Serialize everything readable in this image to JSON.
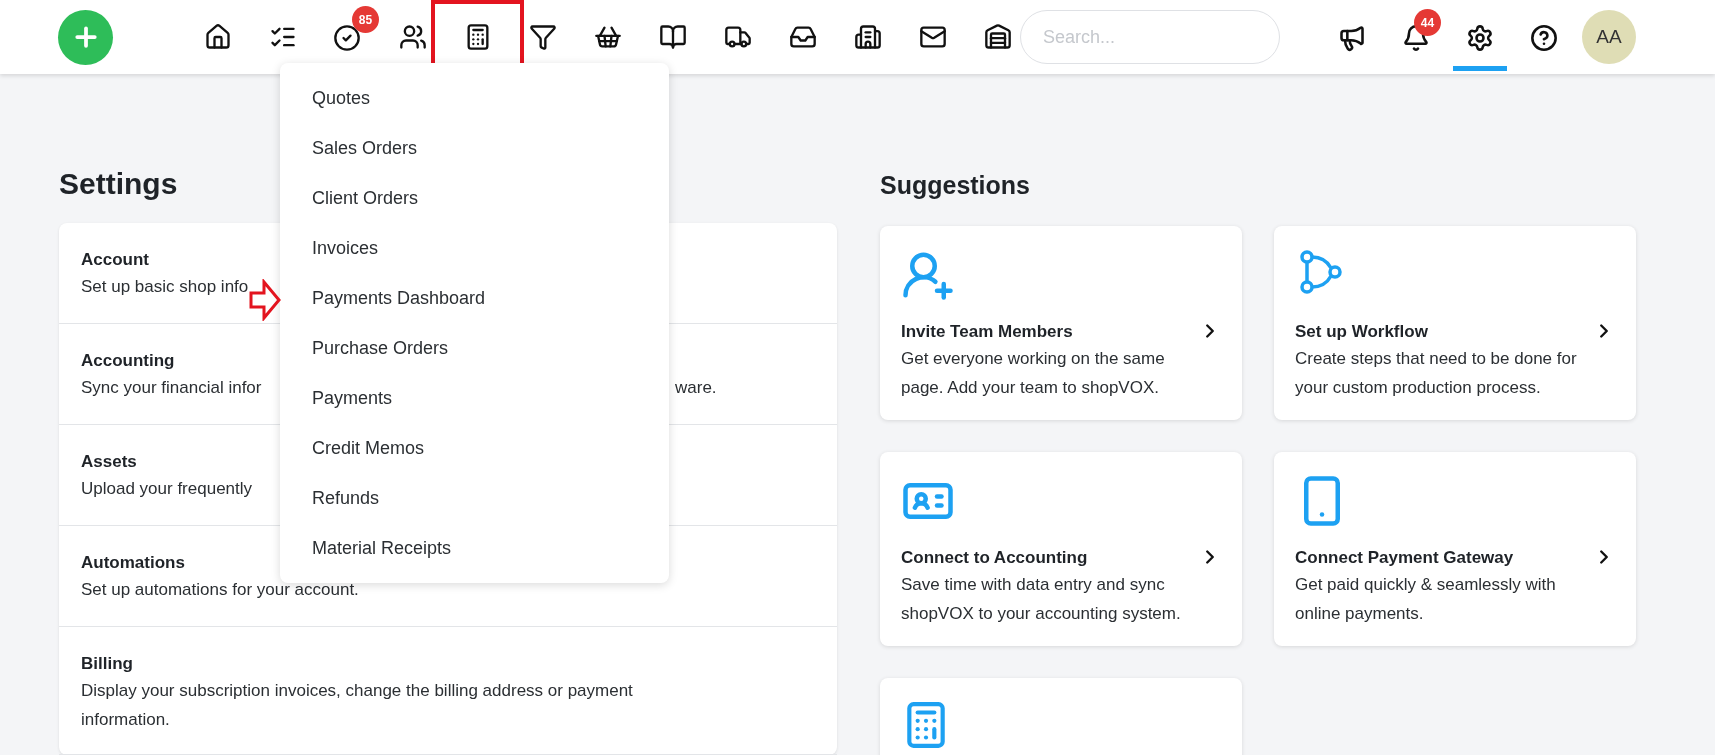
{
  "nav_items": [
    {
      "kind": "home",
      "highlighted": false
    },
    {
      "kind": "tasks",
      "highlighted": false
    },
    {
      "kind": "approvals",
      "highlighted": false,
      "badge": "85"
    },
    {
      "kind": "contacts",
      "highlighted": false
    },
    {
      "kind": "sales",
      "highlighted": true
    },
    {
      "kind": "leads",
      "highlighted": false
    },
    {
      "kind": "products",
      "highlighted": false
    },
    {
      "kind": "pricing",
      "highlighted": false
    },
    {
      "kind": "shipping",
      "highlighted": false
    },
    {
      "kind": "inbox",
      "highlighted": false
    },
    {
      "kind": "reports",
      "highlighted": false
    },
    {
      "kind": "mail",
      "highlighted": false
    },
    {
      "kind": "warehouse",
      "highlighted": false
    }
  ],
  "search": {
    "placeholder": "Search..."
  },
  "right_items": [
    {
      "kind": "announcements",
      "selected": false
    },
    {
      "kind": "notifications",
      "selected": false,
      "badge": "44"
    },
    {
      "kind": "settings",
      "selected": true
    },
    {
      "kind": "help",
      "selected": false
    }
  ],
  "avatar": {
    "initials": "AA"
  },
  "dropdown": [
    {
      "label": "Quotes",
      "pointed": false
    },
    {
      "label": "Sales Orders",
      "pointed": false
    },
    {
      "label": "Client Orders",
      "pointed": false
    },
    {
      "label": "Invoices",
      "pointed": false
    },
    {
      "label": "Payments Dashboard",
      "pointed": true
    },
    {
      "label": "Purchase Orders",
      "pointed": false
    },
    {
      "label": "Payments",
      "pointed": false
    },
    {
      "label": "Credit Memos",
      "pointed": false
    },
    {
      "label": "Refunds",
      "pointed": false
    },
    {
      "label": "Material Receipts",
      "pointed": false
    }
  ],
  "settings": {
    "title": "Settings",
    "items": [
      {
        "title": "Account",
        "description": "Set up basic shop info"
      },
      {
        "title": "Accounting",
        "description": "Sync your financial infor",
        "description_end": "ware."
      },
      {
        "title": "Assets",
        "description": "Upload your frequently"
      },
      {
        "title": "Automations",
        "description": "Set up automations for your account."
      },
      {
        "title": "Billing",
        "description": "Display your subscription invoices, change the billing address or payment information."
      }
    ]
  },
  "suggestions": {
    "title": "Suggestions",
    "cards": [
      {
        "kind": "team",
        "title": "Invite Team Members",
        "description": "Get everyone working on the same page. Add your team to shopVOX."
      },
      {
        "kind": "workflow",
        "title": "Set up Workflow",
        "description": "Create steps that need to be done for your custom production process."
      },
      {
        "kind": "accounting",
        "title": "Connect to Accounting",
        "description": "Save time with data entry and sync shopVOX to your accounting system."
      },
      {
        "kind": "gateway",
        "title": "Connect Payment Gateway",
        "description": "Get paid quickly & seamlessly with online payments."
      },
      {
        "kind": "calculator"
      }
    ]
  }
}
